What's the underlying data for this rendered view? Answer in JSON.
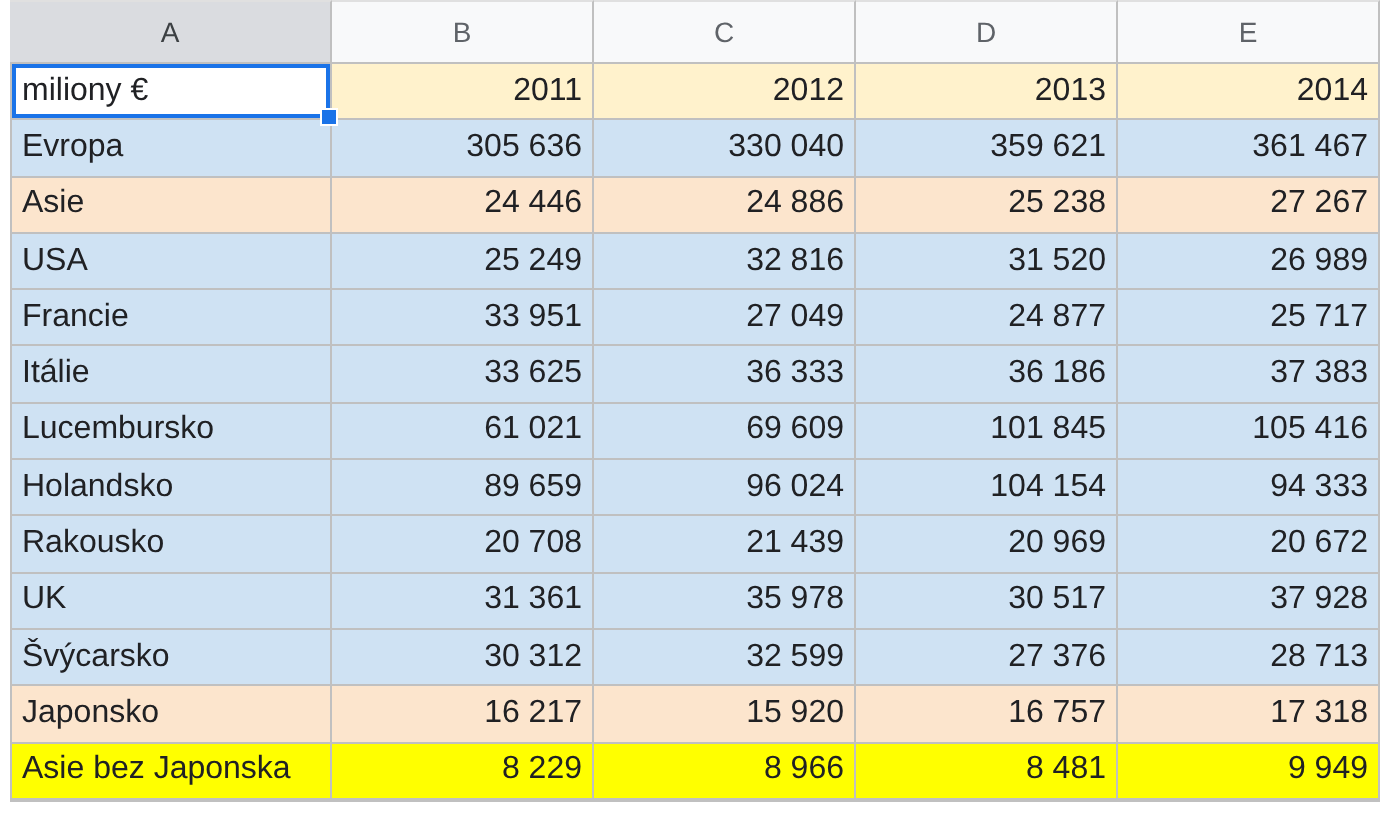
{
  "columns": [
    {
      "label": "A",
      "selected": true
    },
    {
      "label": "B",
      "selected": false
    },
    {
      "label": "C",
      "selected": false
    },
    {
      "label": "D",
      "selected": false
    },
    {
      "label": "E",
      "selected": false
    }
  ],
  "rows": [
    {
      "color": "#fff2cc",
      "cells": [
        {
          "text": "miliony €",
          "selected": true
        },
        {
          "text": "2011",
          "selected": false
        },
        {
          "text": "2012",
          "selected": false
        },
        {
          "text": "2013",
          "selected": false
        },
        {
          "text": "2014",
          "selected": false
        }
      ]
    },
    {
      "color": "#cfe2f3",
      "cells": [
        {
          "text": "Evropa",
          "selected": false
        },
        {
          "text": "305 636",
          "selected": false
        },
        {
          "text": "330 040",
          "selected": false
        },
        {
          "text": "359 621",
          "selected": false
        },
        {
          "text": "361 467",
          "selected": false
        }
      ]
    },
    {
      "color": "#fce5cd",
      "cells": [
        {
          "text": "Asie",
          "selected": false
        },
        {
          "text": "24 446",
          "selected": false
        },
        {
          "text": "24 886",
          "selected": false
        },
        {
          "text": "25 238",
          "selected": false
        },
        {
          "text": "27 267",
          "selected": false
        }
      ]
    },
    {
      "color": "#cfe2f3",
      "cells": [
        {
          "text": "USA",
          "selected": false
        },
        {
          "text": "25 249",
          "selected": false
        },
        {
          "text": "32 816",
          "selected": false
        },
        {
          "text": "31 520",
          "selected": false
        },
        {
          "text": "26 989",
          "selected": false
        }
      ]
    },
    {
      "color": "#cfe2f3",
      "cells": [
        {
          "text": "Francie",
          "selected": false
        },
        {
          "text": "33 951",
          "selected": false
        },
        {
          "text": "27 049",
          "selected": false
        },
        {
          "text": "24 877",
          "selected": false
        },
        {
          "text": "25 717",
          "selected": false
        }
      ]
    },
    {
      "color": "#cfe2f3",
      "cells": [
        {
          "text": "Itálie",
          "selected": false
        },
        {
          "text": "33 625",
          "selected": false
        },
        {
          "text": "36 333",
          "selected": false
        },
        {
          "text": "36 186",
          "selected": false
        },
        {
          "text": "37 383",
          "selected": false
        }
      ]
    },
    {
      "color": "#cfe2f3",
      "cells": [
        {
          "text": "Lucembursko",
          "selected": false
        },
        {
          "text": "61 021",
          "selected": false
        },
        {
          "text": "69 609",
          "selected": false
        },
        {
          "text": "101 845",
          "selected": false
        },
        {
          "text": "105 416",
          "selected": false
        }
      ]
    },
    {
      "color": "#cfe2f3",
      "cells": [
        {
          "text": "Holandsko",
          "selected": false
        },
        {
          "text": "89 659",
          "selected": false
        },
        {
          "text": "96 024",
          "selected": false
        },
        {
          "text": "104 154",
          "selected": false
        },
        {
          "text": "94 333",
          "selected": false
        }
      ]
    },
    {
      "color": "#cfe2f3",
      "cells": [
        {
          "text": "Rakousko",
          "selected": false
        },
        {
          "text": "20 708",
          "selected": false
        },
        {
          "text": "21 439",
          "selected": false
        },
        {
          "text": "20 969",
          "selected": false
        },
        {
          "text": "20 672",
          "selected": false
        }
      ]
    },
    {
      "color": "#cfe2f3",
      "cells": [
        {
          "text": "UK",
          "selected": false
        },
        {
          "text": "31 361",
          "selected": false
        },
        {
          "text": "35 978",
          "selected": false
        },
        {
          "text": "30 517",
          "selected": false
        },
        {
          "text": "37 928",
          "selected": false
        }
      ]
    },
    {
      "color": "#cfe2f3",
      "cells": [
        {
          "text": "Švýcarsko",
          "selected": false
        },
        {
          "text": "30 312",
          "selected": false
        },
        {
          "text": "32 599",
          "selected": false
        },
        {
          "text": "27 376",
          "selected": false
        },
        {
          "text": "28 713",
          "selected": false
        }
      ]
    },
    {
      "color": "#fce5cd",
      "cells": [
        {
          "text": "Japonsko",
          "selected": false
        },
        {
          "text": "16 217",
          "selected": false
        },
        {
          "text": "15 920",
          "selected": false
        },
        {
          "text": "16 757",
          "selected": false
        },
        {
          "text": "17 318",
          "selected": false
        }
      ]
    },
    {
      "color": "#ffff00",
      "cells": [
        {
          "text": "Asie bez Japonska",
          "selected": false
        },
        {
          "text": "8 229",
          "selected": false
        },
        {
          "text": "8 966",
          "selected": false
        },
        {
          "text": "8 481",
          "selected": false
        },
        {
          "text": "9 949",
          "selected": false
        }
      ]
    }
  ]
}
